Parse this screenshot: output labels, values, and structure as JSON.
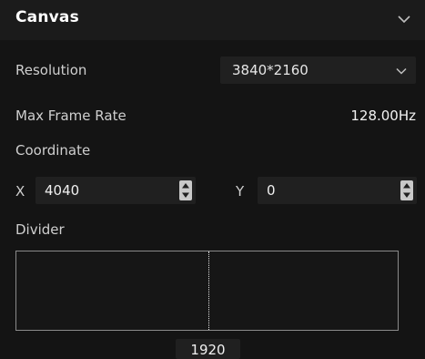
{
  "panel": {
    "title": "Canvas",
    "collapse_icon": "chevron-down-icon"
  },
  "resolution": {
    "label": "Resolution",
    "value": "3840*2160",
    "icon": "chevron-down-icon"
  },
  "max_frame_rate": {
    "label": "Max Frame Rate",
    "value": "128.00Hz"
  },
  "coordinate": {
    "label": "Coordinate",
    "x_label": "X",
    "x_value": "4040",
    "y_label": "Y",
    "y_value": "0",
    "stepper_icon": "spin-arrows-icon"
  },
  "divider": {
    "label": "Divider",
    "value": "1920"
  },
  "colors": {
    "background": "#141414",
    "header": "#1b1b1b",
    "field": "#202020",
    "text": "#d2d2d2",
    "border": "#8a8a8a"
  }
}
